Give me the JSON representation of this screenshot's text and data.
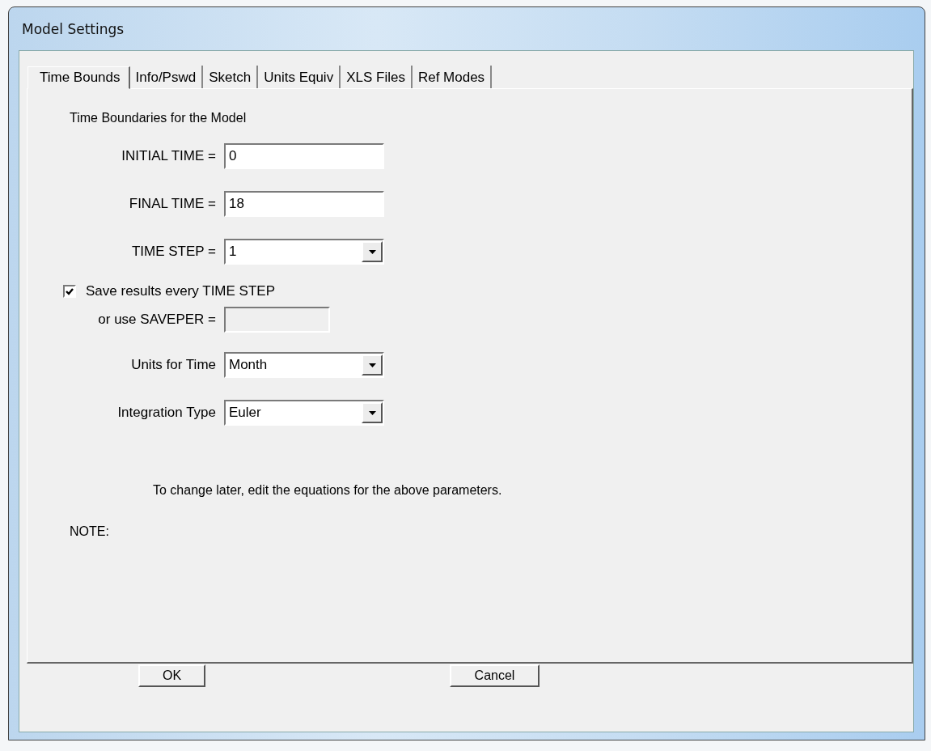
{
  "window": {
    "title": "Model Settings"
  },
  "tabs": [
    {
      "label": "Time Bounds",
      "selected": true
    },
    {
      "label": "Info/Pswd",
      "selected": false
    },
    {
      "label": "Sketch",
      "selected": false
    },
    {
      "label": "Units Equiv",
      "selected": false
    },
    {
      "label": "XLS Files",
      "selected": false
    },
    {
      "label": "Ref Modes",
      "selected": false
    }
  ],
  "heading": "Time Boundaries for the Model",
  "fields": [
    {
      "kind": "text",
      "label": "INITIAL TIME =",
      "value": "0",
      "disabled": false
    },
    {
      "kind": "text",
      "label": "FINAL TIME =",
      "value": "18",
      "disabled": false
    },
    {
      "kind": "combo",
      "label": "TIME STEP =",
      "value": "1"
    },
    {
      "kind": "checkbox",
      "label": "Save results every TIME STEP",
      "checked": true
    },
    {
      "kind": "text",
      "label": "or use SAVEPER =",
      "disabled": true
    },
    {
      "kind": "combo",
      "label": "Units for Time",
      "value": "Month"
    },
    {
      "kind": "combo",
      "label": "Integration Type",
      "value": "Euler"
    }
  ],
  "hint": "To change later, edit the equations for the above parameters.",
  "note_label": "NOTE:",
  "buttons": [
    {
      "label": "OK"
    },
    {
      "label": "Cancel"
    }
  ]
}
